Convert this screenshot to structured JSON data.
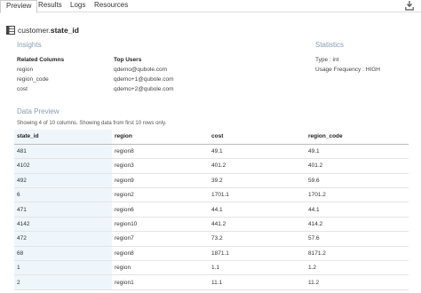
{
  "tabs": [
    "Preview",
    "Results",
    "Logs",
    "Resources"
  ],
  "active_tab": "Preview",
  "header": {
    "prefix": "customer.",
    "column": "state_id"
  },
  "insights": {
    "label": "Insights",
    "related_columns_label": "Related Columns",
    "related_columns": [
      "region",
      "region_code",
      "cost"
    ],
    "top_users_label": "Top Users",
    "top_users": [
      "qdemo@qubole.com",
      "qdemo+1@qubole.com",
      "qdemo+2@qubole.com"
    ]
  },
  "statistics": {
    "label": "Statistics",
    "type_label": "Type",
    "type_value": "int",
    "usage_label": "Usage Frequency",
    "usage_value": "HIGH"
  },
  "preview": {
    "label": "Data Preview",
    "note": "Showing 4 of 10 columns. Showing data from first 10 rows only.",
    "columns": [
      "state_id",
      "region",
      "cost",
      "region_code"
    ],
    "rows": [
      [
        "481",
        "region8",
        "49.1",
        "49.1"
      ],
      [
        "4102",
        "region3",
        "401.2",
        "401.2"
      ],
      [
        "492",
        "region9",
        "39.2",
        "59.6"
      ],
      [
        "6",
        "region2",
        "1701.1",
        "1701.2"
      ],
      [
        "471",
        "region6",
        "44.1",
        "44.1"
      ],
      [
        "4142",
        "region10",
        "441.2",
        "414.2"
      ],
      [
        "472",
        "region7",
        "73.2",
        "57.6"
      ],
      [
        "68",
        "region8",
        "1871.1",
        "8171.2"
      ],
      [
        "1",
        "region",
        "1.1",
        "1.2"
      ],
      [
        "2",
        "region1",
        "11.1",
        "11.2"
      ]
    ]
  }
}
